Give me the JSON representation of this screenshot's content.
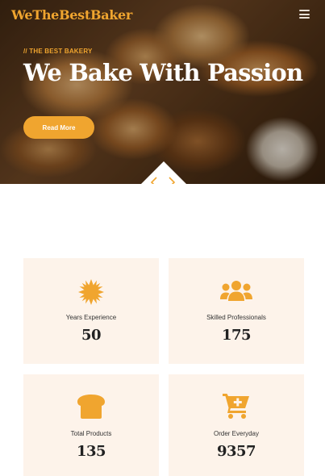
{
  "brand": {
    "logo_text": "WeTheBestBaker",
    "accent": "#f0a52f"
  },
  "nav": {
    "menu_icon": "hamburger-menu-icon"
  },
  "hero": {
    "tagline": "// THE BEST BAKERY",
    "headline": "We Bake With Passion",
    "button_label": "Read More",
    "prev_icon": "chevron-left-icon",
    "next_icon": "chevron-right-icon"
  },
  "stats": [
    {
      "label": "Years Experience",
      "value": "50",
      "icon": "sun-badge-icon"
    },
    {
      "label": "Skilled Professionals",
      "value": "175",
      "icon": "users-group-icon"
    },
    {
      "label": "Total Products",
      "value": "135",
      "icon": "bread-icon"
    },
    {
      "label": "Order Everyday",
      "value": "9357",
      "icon": "cart-plus-icon"
    }
  ],
  "colors": {
    "card_bg": "#fdf3ea",
    "accent": "#f0a52f",
    "text_dark": "#222222"
  }
}
